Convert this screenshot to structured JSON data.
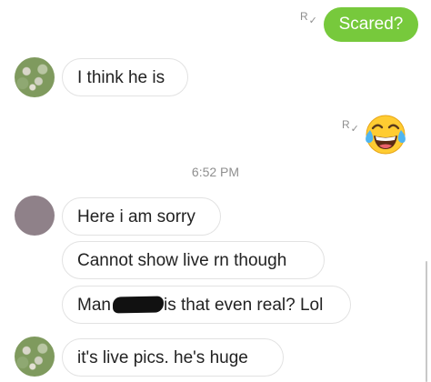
{
  "messages": {
    "outgoing_1": "Scared?",
    "incoming_1": "I think he is",
    "timestamp": "6:52 PM",
    "incoming_2": "Here i am sorry",
    "incoming_3": "Cannot show live rn though",
    "incoming_4_before": "Man",
    "incoming_4_after": "is that even real? Lol",
    "incoming_5": "it's live pics. he's huge"
  },
  "read_receipt": {
    "letter": "R",
    "check": "✓"
  },
  "icons": {
    "read_receipt": "read-receipt-icon",
    "emoji": "tears-of-joy-emoji",
    "redaction": "redaction-scribble"
  },
  "colors": {
    "outgoing_bubble": "#77c93c",
    "incoming_border": "#e2e2e2",
    "timestamp": "#8f8f8f",
    "blank_avatar": "#8f8189"
  }
}
